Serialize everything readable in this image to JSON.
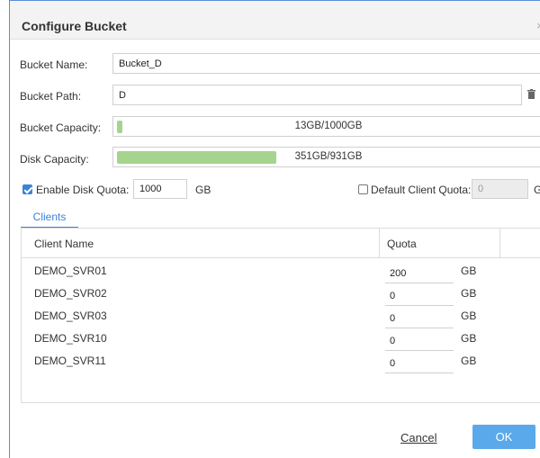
{
  "dialog": {
    "title": "Configure Bucket",
    "close_icon": "close-icon"
  },
  "form": {
    "bucket_name_label": "Bucket Name:",
    "bucket_name_value": "Bucket_D",
    "bucket_path_label": "Bucket Path:",
    "bucket_path_value": "D",
    "bucket_capacity_label": "Bucket Capacity:",
    "bucket_capacity_text": "13GB/1000GB",
    "bucket_capacity_fraction": 0.013,
    "disk_capacity_label": "Disk Capacity:",
    "disk_capacity_text": "351GB/931GB",
    "disk_capacity_fraction": 0.377,
    "enable_quota_checked": true,
    "enable_quota_label": "Enable Disk Quota:",
    "enable_quota_value": "1000",
    "enable_quota_unit": "GB",
    "default_client_quota_checked": false,
    "default_client_quota_label": "Default Client Quota:",
    "default_client_quota_value": "0",
    "default_client_quota_unit": "G"
  },
  "tabs": [
    {
      "label": "Clients",
      "active": true
    }
  ],
  "table": {
    "columns": [
      "Client Name",
      "Quota"
    ],
    "rows": [
      {
        "name": "DEMO_SVR01",
        "quota": "200",
        "unit": "GB"
      },
      {
        "name": "DEMO_SVR02",
        "quota": "0",
        "unit": "GB"
      },
      {
        "name": "DEMO_SVR03",
        "quota": "0",
        "unit": "GB"
      },
      {
        "name": "DEMO_SVR10",
        "quota": "0",
        "unit": "GB"
      },
      {
        "name": "DEMO_SVR11",
        "quota": "0",
        "unit": "GB"
      }
    ]
  },
  "buttons": {
    "cancel": "Cancel",
    "ok": "OK"
  },
  "colors": {
    "accent": "#3b82d8",
    "ok_button": "#5aa9ea",
    "capacity_fill": "#a5d48e"
  }
}
